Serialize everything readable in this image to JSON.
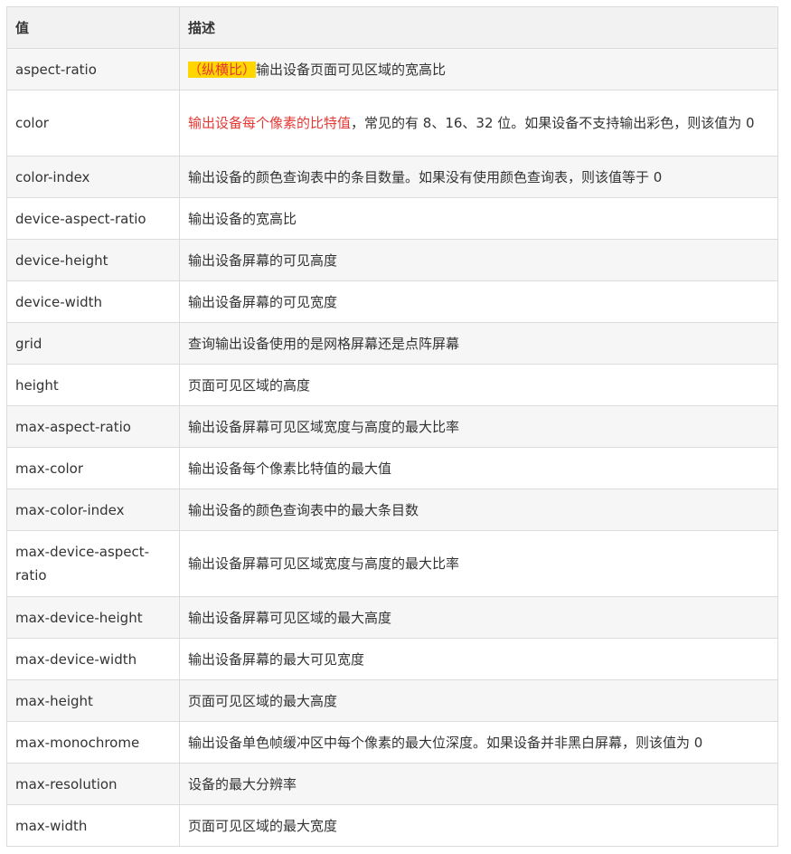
{
  "table": {
    "headers": [
      "值",
      "描述"
    ],
    "rows": [
      {
        "value": "aspect-ratio",
        "highlight": "（纵横比）",
        "desc": "输出设备页面可见区域的宽高比"
      },
      {
        "value": "color",
        "red": "输出设备每个像素的比特值",
        "desc": "，常见的有 8、16、32 位。如果设备不支持输出彩色，则该值为 0"
      },
      {
        "value": "color-index",
        "desc": "输出设备的颜色查询表中的条目数量。如果没有使用颜色查询表，则该值等于 0"
      },
      {
        "value": "device-aspect-ratio",
        "desc": "输出设备的宽高比"
      },
      {
        "value": "device-height",
        "desc": "输出设备屏幕的可见高度"
      },
      {
        "value": "device-width",
        "desc": "输出设备屏幕的可见宽度"
      },
      {
        "value": "grid",
        "desc": "查询输出设备使用的是网格屏幕还是点阵屏幕"
      },
      {
        "value": "height",
        "desc": "页面可见区域的高度"
      },
      {
        "value": "max-aspect-ratio",
        "desc": "输出设备屏幕可见区域宽度与高度的最大比率"
      },
      {
        "value": "max-color",
        "desc": "输出设备每个像素比特值的最大值"
      },
      {
        "value": "max-color-index",
        "desc": "输出设备的颜色查询表中的最大条目数"
      },
      {
        "value": "max-device-aspect-ratio",
        "desc": "输出设备屏幕可见区域宽度与高度的最大比率"
      },
      {
        "value": "max-device-height",
        "desc": "输出设备屏幕可见区域的最大高度"
      },
      {
        "value": "max-device-width",
        "desc": "输出设备屏幕的最大可见宽度"
      },
      {
        "value": "max-height",
        "desc": "页面可见区域的最大高度"
      },
      {
        "value": "max-monochrome",
        "desc": "输出设备单色帧缓冲区中每个像素的最大位深度。如果设备并非黑白屏幕，则该值为 0"
      },
      {
        "value": "max-resolution",
        "desc": "设备的最大分辨率"
      },
      {
        "value": "max-width",
        "desc": "页面可见区域的最大宽度"
      }
    ]
  },
  "colors": {
    "highlight_bg": "#ffd600",
    "highlight_text": "#e53935",
    "border": "#dcdcdc",
    "header_bg": "#f2f2f2",
    "stripe_bg": "#f6f6f6"
  }
}
